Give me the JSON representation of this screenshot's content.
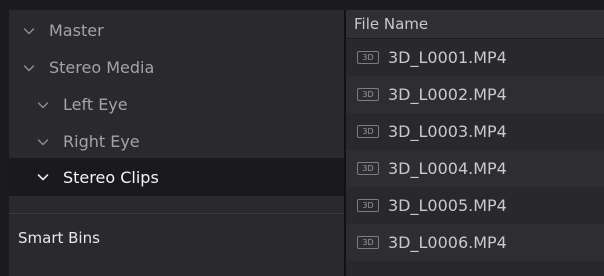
{
  "bins": {
    "items": [
      {
        "label": "Master",
        "icon": "chevron-down-icon",
        "selected": false
      },
      {
        "label": "Stereo Media",
        "icon": "chevron-down-icon",
        "selected": false
      },
      {
        "label": "Left Eye",
        "icon": "chevron-down-icon",
        "selected": false
      },
      {
        "label": "Right Eye",
        "icon": "chevron-down-icon",
        "selected": false
      },
      {
        "label": "Stereo Clips",
        "icon": "chevron-down-icon",
        "selected": true
      }
    ],
    "smart_bins_label": "Smart Bins"
  },
  "media": {
    "column_header": "File Name",
    "clips": [
      {
        "badge": "3D",
        "name": "3D_L0001.MP4"
      },
      {
        "badge": "3D",
        "name": "3D_L0002.MP4"
      },
      {
        "badge": "3D",
        "name": "3D_L0003.MP4"
      },
      {
        "badge": "3D",
        "name": "3D_L0004.MP4"
      },
      {
        "badge": "3D",
        "name": "3D_L0005.MP4"
      },
      {
        "badge": "3D",
        "name": "3D_L0006.MP4"
      }
    ]
  },
  "colors": {
    "panel": "#2a2a2d",
    "selected_row": "#1a1a1c",
    "text_muted": "#a3a3a8",
    "text_active": "#f4f4f6"
  }
}
